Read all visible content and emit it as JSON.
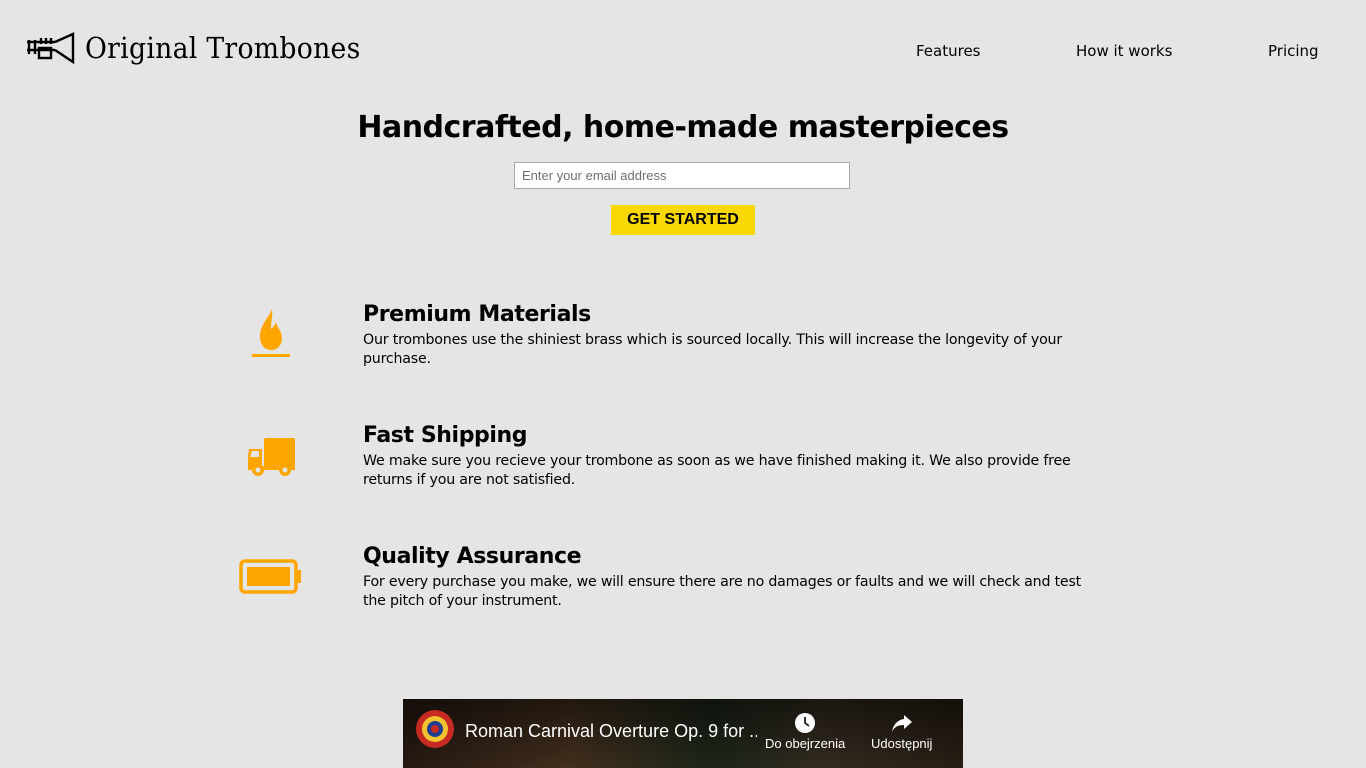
{
  "brand": {
    "name": "Original Trombones",
    "logo_icon": "trumpet-icon"
  },
  "nav": {
    "items": [
      "Features",
      "How it works",
      "Pricing"
    ]
  },
  "hero": {
    "title": "Handcrafted, home-made masterpieces",
    "email_placeholder": "Enter your email address",
    "email_value": "",
    "cta_label": "GET STARTED"
  },
  "features": [
    {
      "icon": "fire-icon",
      "title": "Premium Materials",
      "text": "Our trombones use the shiniest brass which is sourced locally. This will increase the longevity of your purchase."
    },
    {
      "icon": "truck-icon",
      "title": "Fast Shipping",
      "text": "We make sure you recieve your trombone as soon as we have finished making it. We also provide free returns if you are not satisfied."
    },
    {
      "icon": "battery-icon",
      "title": "Quality Assurance",
      "text": "For every purchase you make, we will ensure there are no damages or faults and we will check and test the pitch of your instrument."
    }
  ],
  "video": {
    "title": "Roman Carnival Overture Op. 9 for ...",
    "watch_later_label": "Do obejrzenia",
    "share_label": "Udostępnij"
  },
  "colors": {
    "background": "#e5e5e5",
    "accent": "#f9d806",
    "icon": "#ffa500"
  }
}
